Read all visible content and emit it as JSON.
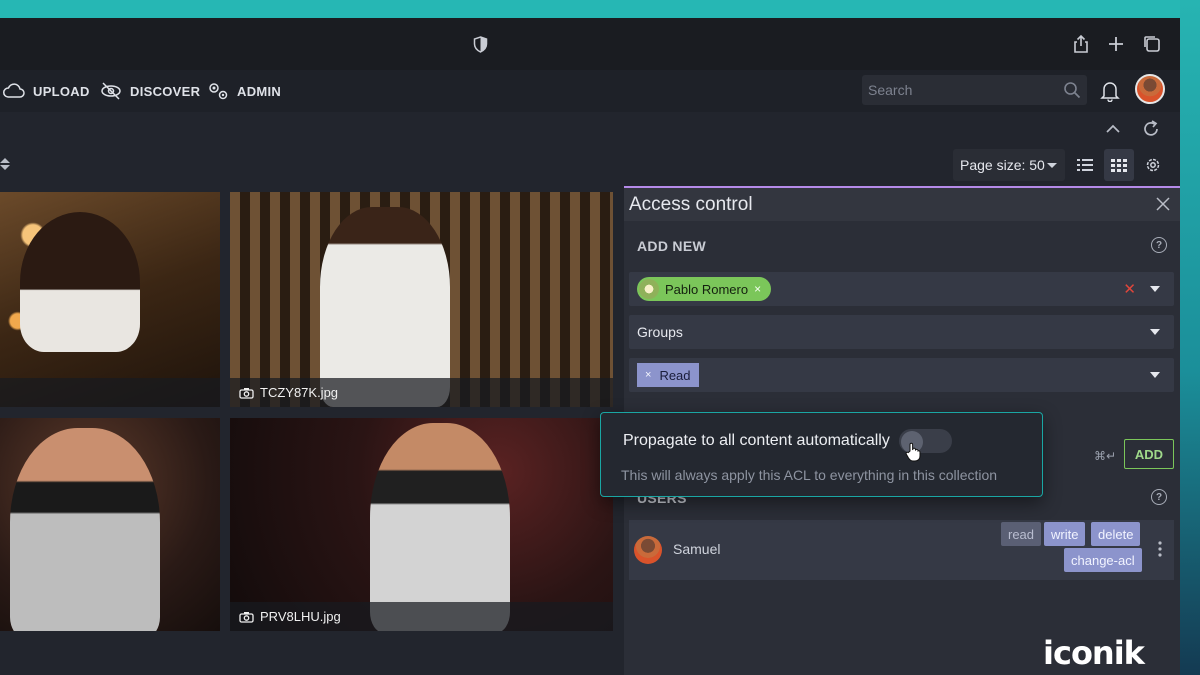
{
  "nav": {
    "upload": "UPLOAD",
    "discover": "DISCOVER",
    "admin": "ADMIN",
    "search_placeholder": "Search"
  },
  "toolbar": {
    "page_size": "Page size: 50"
  },
  "assets": [
    {
      "filename": ""
    },
    {
      "filename": "TCZY87K.jpg"
    },
    {
      "filename": ""
    },
    {
      "filename": "PRV8LHU.jpg"
    }
  ],
  "access_control": {
    "title": "Access control",
    "add_new_label": "ADD NEW",
    "help": "?",
    "selected_user": "Pablo Romero",
    "chip_remove": "×",
    "clear": "✕",
    "groups_placeholder": "Groups",
    "selected_permission": "Read",
    "shortcut": "⌘↵",
    "add_button": "ADD",
    "users_label": "USERS",
    "users": [
      {
        "name": "Samuel",
        "permissions": [
          {
            "label": "read",
            "active": false
          },
          {
            "label": "write",
            "active": true
          },
          {
            "label": "delete",
            "active": true
          },
          {
            "label": "change-acl",
            "active": true
          }
        ]
      }
    ]
  },
  "propagate_popup": {
    "title": "Propagate to all content automatically",
    "description": "This will always apply this ACL to everything in this collection",
    "enabled": false
  },
  "brand": {
    "logo": "iconik"
  },
  "colors": {
    "accent": "#b58ae8",
    "teal": "#1aa6a3",
    "green": "#7bc65a",
    "permission": "#8c94cc",
    "danger": "#e0463b"
  }
}
